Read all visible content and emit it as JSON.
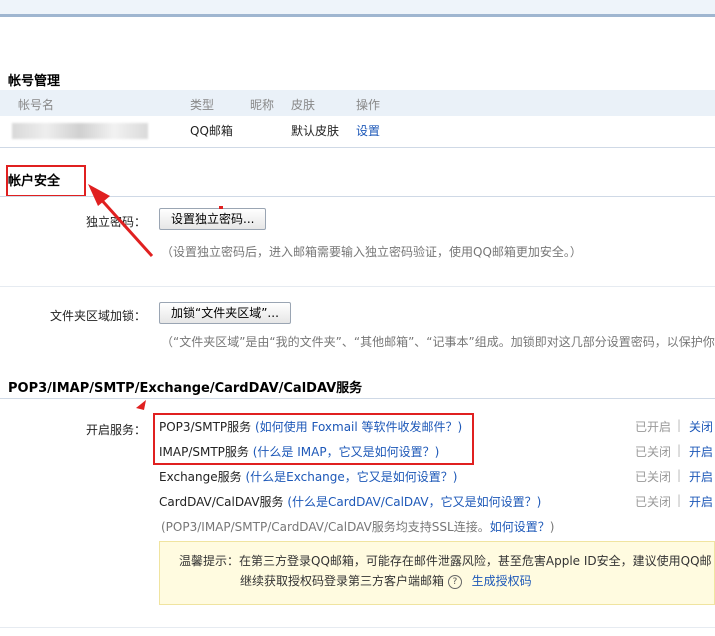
{
  "account_section": {
    "title": "帐号管理",
    "columns": [
      "帐号名",
      "类型",
      "昵称",
      "皮肤",
      "操作"
    ],
    "row": {
      "type": "QQ邮箱",
      "nickname": "",
      "skin": "默认皮肤",
      "action": "设置"
    }
  },
  "security_section": {
    "title": "帐户安全",
    "password_label": "独立密码：",
    "password_button": "设置独立密码...",
    "password_hint": "（设置独立密码后，进入邮箱需要输入独立密码验证，使用QQ邮箱更加安全。）",
    "folder_label": "文件夹区域加锁：",
    "folder_button": "加锁“文件夹区域”...",
    "folder_hint": "（“文件夹区域”是由“我的文件夹”、“其他邮箱”、“记事本”组成。加锁即对这几部分设置密码，以保护你的信"
  },
  "services_section": {
    "title": "POP3/IMAP/SMTP/Exchange/CardDAV/CalDAV服务",
    "label": "开启服务：",
    "services": [
      {
        "name": "POP3/SMTP服务",
        "help": "(如何使用 Foxmail 等软件收发邮件？)",
        "status": "已开启",
        "toggle": "关闭"
      },
      {
        "name": "IMAP/SMTP服务",
        "help": "(什么是 IMAP，它又是如何设置？)",
        "status": "已关闭",
        "toggle": "开启"
      },
      {
        "name": "Exchange服务",
        "help": "(什么是Exchange，它又是如何设置？)",
        "status": "已关闭",
        "toggle": "开启"
      },
      {
        "name": "CardDAV/CalDAV服务",
        "help": "(什么是CardDAV/CalDAV，它又是如何设置？)",
        "status": "已关闭",
        "toggle": "开启"
      }
    ],
    "ssl_prefix": "(POP3/IMAP/SMTP/CardDAV/CalDAV服务均支持SSL连接。",
    "ssl_link": "如何设置？",
    "ssl_suffix": ")",
    "notice_line1": "温馨提示：在第三方登录QQ邮箱，可能存在邮件泄露风险，甚至危害Apple ID安全，建议使用QQ邮",
    "notice_line2": "继续获取授权码登录第三方客户端邮箱",
    "notice_help_icon": "?",
    "notice_link": "生成授权码"
  },
  "separator": "|",
  "colors": {
    "accent": "#1d58b8",
    "annotation": "#e02020",
    "header_bg": "#eaf1f8"
  }
}
